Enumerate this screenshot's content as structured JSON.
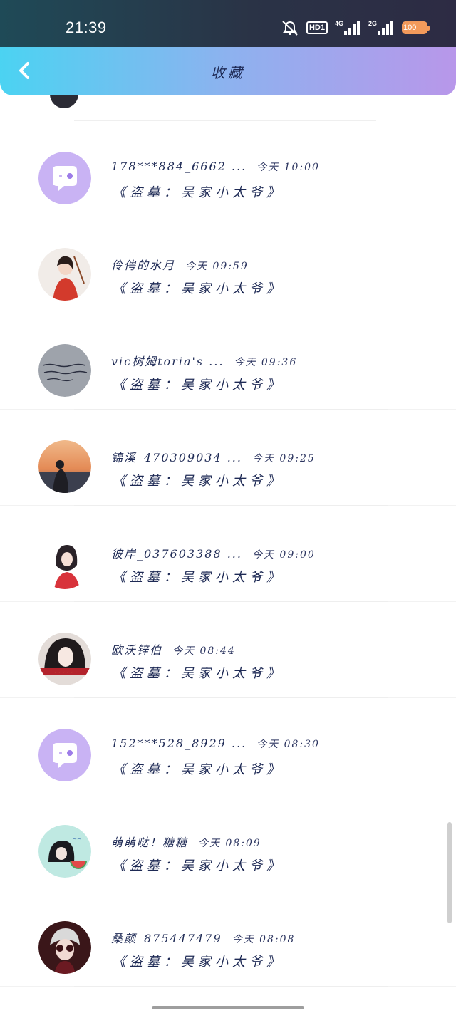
{
  "status_bar": {
    "time": "21:39",
    "hd": "HD1",
    "net1": "4G",
    "net2": "2G",
    "battery": "100",
    "icons": [
      "mute-bell-icon",
      "hd-icon",
      "signal-4g-icon",
      "signal-2g-icon",
      "battery-icon"
    ]
  },
  "header": {
    "title": "收藏",
    "back_icon": "chevron-left-icon"
  },
  "colors": {
    "header_gradient_start": "#4bd3f2",
    "header_gradient_end": "#b897ea",
    "text_primary": "#1e2a55",
    "default_avatar_bg": "#c9b3f4"
  },
  "items": [
    {
      "name": "178***884_6662 ...",
      "time": "今天 10:00",
      "content": "《盗墓：吴家小太爷》",
      "avatar": "default-chat-avatar"
    },
    {
      "name": "伶俜的水月",
      "time": "今天 09:59",
      "content": "《盗墓：吴家小太爷》",
      "avatar": "photo-avatar"
    },
    {
      "name": "vic树姆toria's ...",
      "time": "今天 09:36",
      "content": "《盗墓：吴家小太爷》",
      "avatar": "photo-avatar"
    },
    {
      "name": "锦溪_470309034 ...",
      "time": "今天 09:25",
      "content": "《盗墓：吴家小太爷》",
      "avatar": "photo-avatar"
    },
    {
      "name": "彼岸_037603388 ...",
      "time": "今天 09:00",
      "content": "《盗墓：吴家小太爷》",
      "avatar": "photo-avatar"
    },
    {
      "name": "欧沃锌伯",
      "time": "今天 08:44",
      "content": "《盗墓：吴家小太爷》",
      "avatar": "photo-avatar"
    },
    {
      "name": "152***528_8929 ...",
      "time": "今天 08:30",
      "content": "《盗墓：吴家小太爷》",
      "avatar": "default-chat-avatar"
    },
    {
      "name": "萌萌哒！糖糖",
      "time": "今天 08:09",
      "content": "《盗墓：吴家小太爷》",
      "avatar": "photo-avatar"
    },
    {
      "name": "桑颜_875447479",
      "time": "今天 08:08",
      "content": "《盗墓：吴家小太爷》",
      "avatar": "photo-avatar"
    }
  ]
}
